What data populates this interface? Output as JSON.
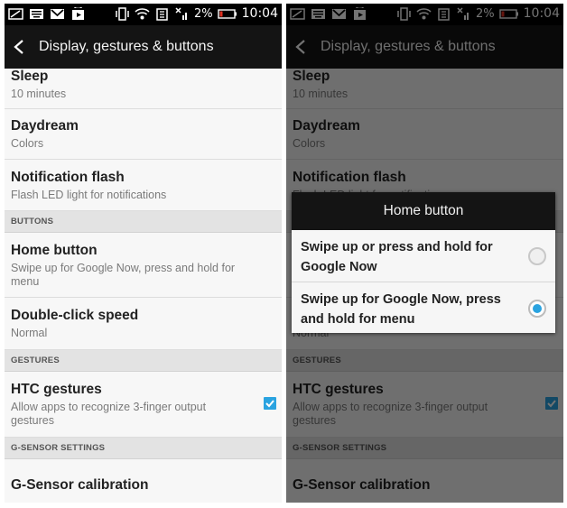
{
  "status": {
    "battery": "2%",
    "time": "10:04"
  },
  "appbar": {
    "title": "Display, gestures & buttons"
  },
  "settings": {
    "sleep": {
      "title": "Sleep",
      "value": "10 minutes"
    },
    "daydream": {
      "title": "Daydream",
      "value": "Colors"
    },
    "notification_flash": {
      "title": "Notification flash",
      "value": "Flash LED light for notifications"
    },
    "section_buttons": "BUTTONS",
    "home_button": {
      "title": "Home button",
      "value": "Swipe up for Google Now, press and hold for menu"
    },
    "double_click": {
      "title": "Double-click speed",
      "value": "Normal"
    },
    "section_gestures": "GESTURES",
    "htc_gestures": {
      "title": "HTC gestures",
      "value": "Allow apps to recognize 3-finger output gestures",
      "checked": true
    },
    "section_gsensor": "G-SENSOR SETTINGS",
    "gsensor": {
      "title": "G-Sensor calibration"
    }
  },
  "dialog": {
    "title": "Home button",
    "options": [
      {
        "label": "Swipe up or press and hold for Google Now",
        "selected": false
      },
      {
        "label": "Swipe up for Google Now, press and hold for menu",
        "selected": true
      }
    ]
  },
  "colors": {
    "accent": "#2aa3e0",
    "appbar": "#141414",
    "statusbar": "#000000"
  }
}
